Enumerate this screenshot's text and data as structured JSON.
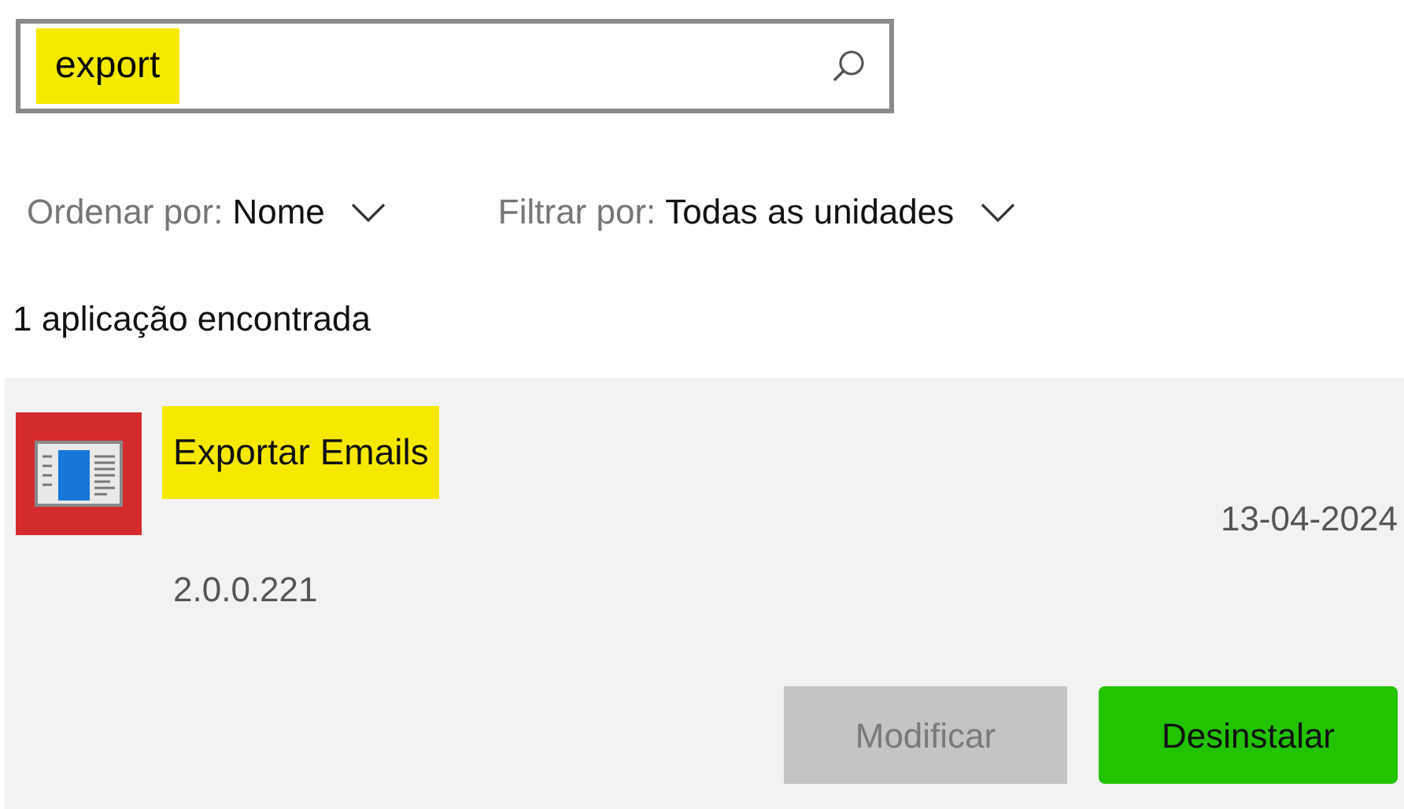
{
  "search": {
    "value": "export",
    "highlighted": true
  },
  "sort": {
    "label": "Ordenar por:",
    "value": "Nome"
  },
  "filter": {
    "label": "Filtrar por:",
    "value": "Todas as unidades"
  },
  "result_count": "1 aplicação encontrada",
  "app": {
    "name": "Exportar Emails",
    "name_highlighted": true,
    "date": "13-04-2024",
    "version": "2.0.0.221",
    "buttons": [
      {
        "label": "Modificar",
        "disabled": true,
        "highlighted": false
      },
      {
        "label": "Desinstalar",
        "disabled": false,
        "highlighted": true
      }
    ]
  }
}
